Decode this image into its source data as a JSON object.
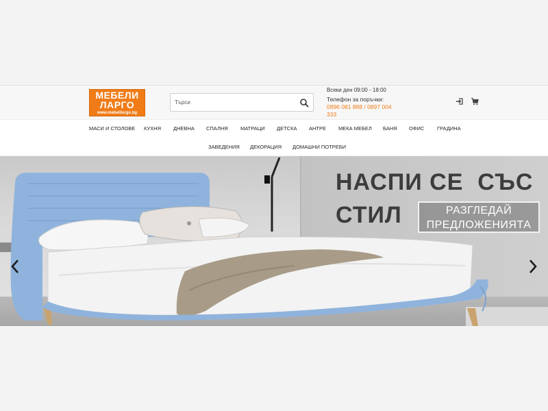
{
  "brand": {
    "line1": "МЕБЕЛИ",
    "line2": "ЛАРГО",
    "url": "www.mebelilargo.bg",
    "color": "#f07c17"
  },
  "search": {
    "placeholder": "Търси",
    "icon": "search-icon"
  },
  "contact": {
    "hours": "Всеки ден 09:00 - 18:00",
    "phone_label": "Телефон за поръчки:",
    "phones_line1": "0896 081 888 / 0897 004",
    "phones_line2": "333",
    "phone_color": "#f07c17"
  },
  "header_icons": [
    "login-icon",
    "cart-icon"
  ],
  "nav": {
    "row1": [
      "Маси и столове",
      "Кухня",
      "Дневна",
      "Спалня",
      "Матраци",
      "Детска",
      "Антре",
      "Мека мебел",
      "Баня",
      "Офис",
      "Градина"
    ],
    "row2": [
      "Заведения",
      "Декорация",
      "Домашни потреби"
    ]
  },
  "hero": {
    "headline_line1": "НАСПИ СЕ  СЪС",
    "headline_line2": "СТИЛ",
    "cta_line1": "РАЗГЛЕДАЙ",
    "cta_line2": "ПРЕДЛОЖЕНИЯТА",
    "prev_icon": "chevron-left-icon",
    "next_icon": "chevron-right-icon"
  }
}
